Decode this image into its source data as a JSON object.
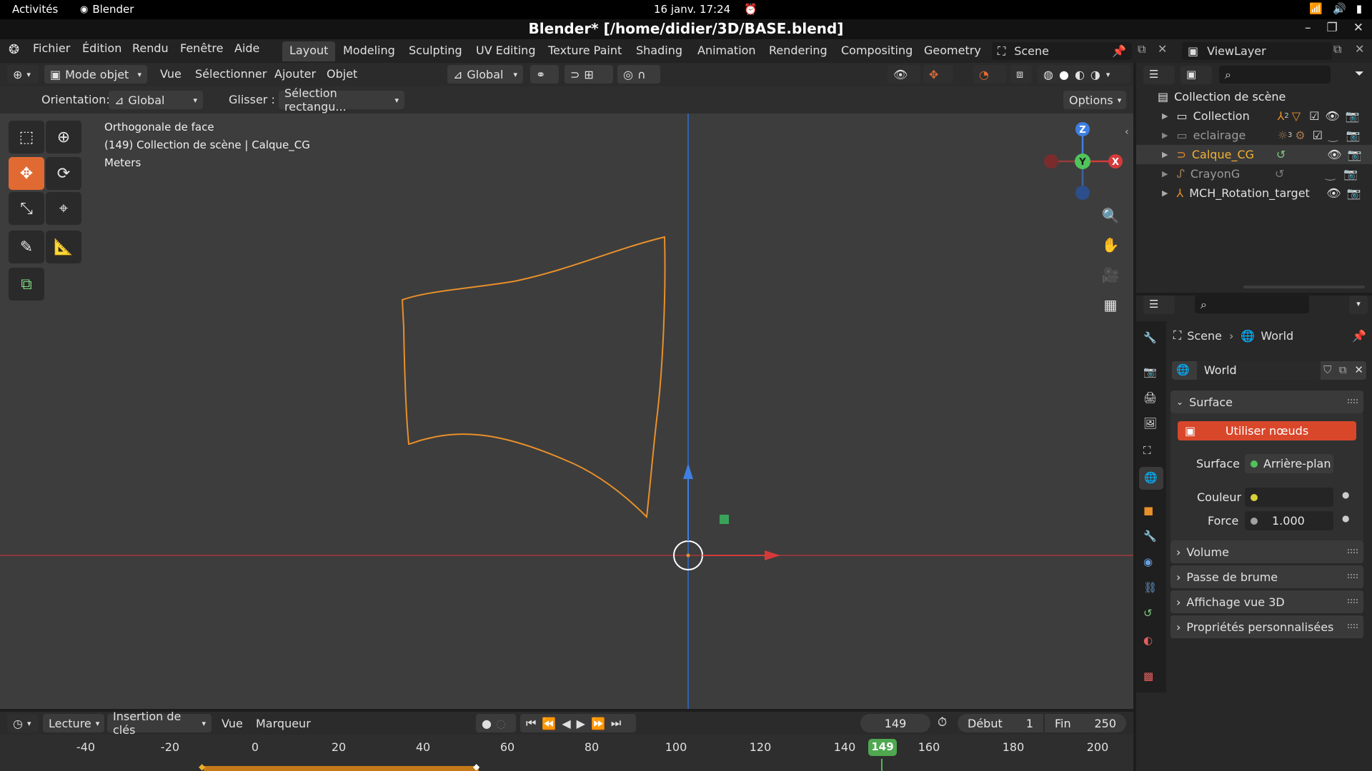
{
  "system": {
    "activities": "Activités",
    "app_name": "Blender",
    "clock": "16 janv.  17:24"
  },
  "window": {
    "title": "Blender* [/home/didier/3D/BASE.blend]"
  },
  "menu": {
    "items": [
      "Fichier",
      "Édition",
      "Rendu",
      "Fenêtre",
      "Aide"
    ]
  },
  "workspaces": {
    "tabs": [
      "Layout",
      "Modeling",
      "Sculpting",
      "UV Editing",
      "Texture Paint",
      "Shading",
      "Animation",
      "Rendering",
      "Compositing",
      "Geometry N"
    ],
    "active": "Layout"
  },
  "scene_selector": {
    "value": "Scene"
  },
  "viewlayer_selector": {
    "value": "ViewLayer"
  },
  "viewport_header": {
    "mode": "Mode objet",
    "menus": [
      "Vue",
      "Sélectionner",
      "Ajouter",
      "Objet"
    ],
    "transform_orientation": "Global"
  },
  "tool_settings": {
    "orientation_label": "Orientation:",
    "orientation_value": "Global",
    "drag_label": "Glisser :",
    "drag_value": "Sélection rectangu...",
    "options_label": "Options"
  },
  "viewport": {
    "view_name": "Orthogonale de face",
    "context": "(149) Collection de scène | Calque_CG",
    "units": "Meters",
    "gizmo": {
      "z": "Z",
      "y": "Y",
      "x": "X"
    },
    "colors": {
      "background": "#3d3d3d",
      "curve": "#e8902a",
      "x_axis": "#c23a3a",
      "z_axis": "#2f6fcf"
    }
  },
  "outliner": {
    "root": "Collection de scène",
    "items": [
      {
        "name": "Collection",
        "color": "#e0e0e0",
        "selected": false,
        "badge": "2"
      },
      {
        "name": "eclairage",
        "color": "#9a9a9a",
        "selected": false,
        "badge": "3"
      },
      {
        "name": "Calque_CG",
        "color": "#f2b233",
        "selected": true,
        "badge": ""
      },
      {
        "name": "CrayonG",
        "color": "#9a9a9a",
        "selected": false,
        "badge": ""
      },
      {
        "name": "MCH_Rotation_target",
        "color": "#e0e0e0",
        "selected": false,
        "badge": ""
      }
    ]
  },
  "properties": {
    "breadcrumb": [
      "Scene",
      "World"
    ],
    "world_name": "World",
    "surface_panel": "Surface",
    "use_nodes": "Utiliser nœuds",
    "surface_label": "Surface",
    "surface_value": "Arrière-plan",
    "color_label": "Couleur",
    "strength_label": "Force",
    "strength_value": "1.000",
    "collapsed_panels": [
      "Volume",
      "Passe de brume",
      "Affichage vue 3D",
      "Propriétés personnalisées"
    ],
    "accent": "#d9472b"
  },
  "timeline": {
    "menus": [
      "Lecture",
      "Insertion de clés",
      "Vue",
      "Marqueur"
    ],
    "current_frame": "149",
    "start_label": "Début",
    "start_value": "1",
    "end_label": "Fin",
    "end_value": "250",
    "ruler_ticks": [
      "-40",
      "-20",
      "0",
      "20",
      "40",
      "60",
      "80",
      "100",
      "120",
      "140",
      "160",
      "180",
      "200"
    ],
    "playhead_label": "149"
  }
}
